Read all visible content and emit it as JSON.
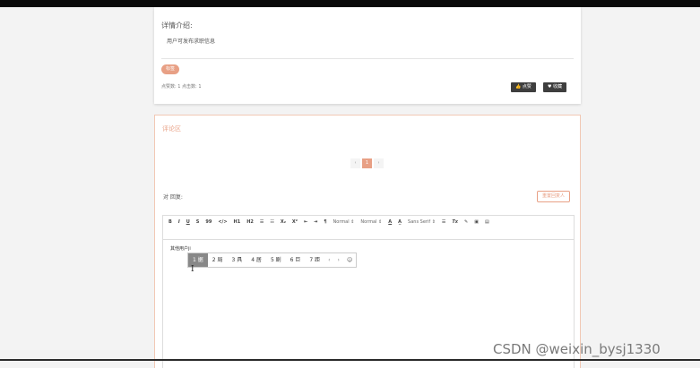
{
  "detail": {
    "label": "详情介绍:",
    "text": "用户可发布求职信息",
    "tag": "标签",
    "stats": "点赞数: 1   点击数: 1",
    "like_label": "👍 点赞",
    "fav_label": "♥ 收藏"
  },
  "comments": {
    "title": "评论区",
    "pagination": [
      "‹",
      "1",
      "›"
    ],
    "reply_label": "对 回复:",
    "reply_button": "重置回复人"
  },
  "editor": {
    "toolbar": [
      "B",
      "I",
      "U",
      "S",
      "99",
      "</>",
      "H1",
      "H2",
      "☰",
      "☷",
      "X₂",
      "X²",
      "⇤",
      "⇥",
      "¶",
      "Normal ⇕",
      "Normal ⇕",
      "A",
      "A̲",
      "Sans Serif ⇕",
      "☰",
      "Tx",
      "✎",
      "▣",
      "▤"
    ],
    "text": "其他用户ji"
  },
  "ime": {
    "candidates": [
      "1 据",
      "2 局",
      "3 具",
      "4 居",
      "5 剧",
      "6 巨",
      "7 距"
    ],
    "prev": "‹",
    "next": "›",
    "emoji": "☺"
  },
  "cursor": "I",
  "watermark": "CSDN @weixin_bysj1330"
}
